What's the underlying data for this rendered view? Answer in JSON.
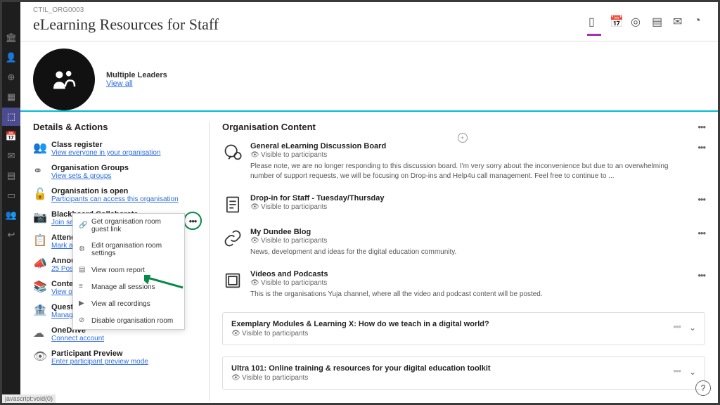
{
  "crumb": "CTIL_ORG0003",
  "title": "eLearning Resources for Staff",
  "leaders": {
    "heading": "Multiple Leaders",
    "link": "View all"
  },
  "details_heading": "Details & Actions",
  "details": [
    {
      "title": "Class register",
      "link": "View everyone in your organisation"
    },
    {
      "title": "Organisation Groups",
      "link": "View sets & groups"
    },
    {
      "title": "Organisation is open",
      "link": "Participants can access this organisation"
    },
    {
      "title": "Blackboard Collaborate",
      "link": "Join session ▾"
    },
    {
      "title": "Attendance",
      "link": "Mark attendance"
    },
    {
      "title": "Announcements",
      "link": "25 Posted | 25"
    },
    {
      "title": "Content & Tools",
      "link": "View organisation"
    },
    {
      "title": "Question Banks",
      "link": "Manage banks"
    },
    {
      "title": "OneDrive",
      "link": "Connect account"
    },
    {
      "title": "Participant Preview",
      "link": "Enter participant preview mode"
    }
  ],
  "dropdown": [
    "Get organisation room guest link",
    "Edit organisation room settings",
    "View room report",
    "Manage all sessions",
    "View all recordings",
    "Disable organisation room"
  ],
  "content_heading": "Organisation Content",
  "visible": "Visible to participants",
  "items": [
    {
      "title": "General eLearning Discussion Board",
      "desc": "Please note, we are no longer responding to this discussion board. I'm very sorry about the inconvenience but due to an overwhelming number of support requests, we will be focusing on Drop-ins and Help4u call management. Feel free to continue to ..."
    },
    {
      "title": "Drop-in for Staff - Tuesday/Thursday",
      "desc": ""
    },
    {
      "title": "My Dundee Blog",
      "desc": "News, development and ideas for the digital education community."
    },
    {
      "title": "Videos and Podcasts",
      "desc": "This is the organisations Yuja channel, where all the video and podcast content will be posted."
    }
  ],
  "folders": [
    {
      "title": "Exemplary Modules & Learning X: How do we teach in a digital world?"
    },
    {
      "title": "Ultra 101: Online training & resources for your digital education toolkit"
    }
  ],
  "statusbar": "javascript:void(0)"
}
